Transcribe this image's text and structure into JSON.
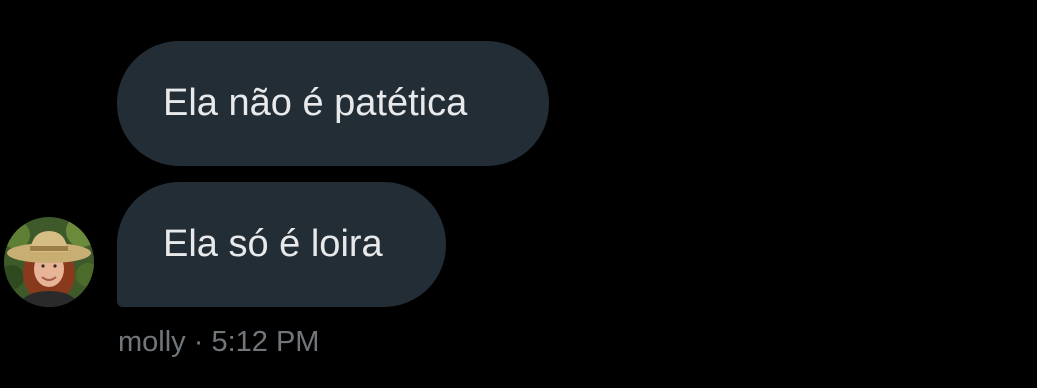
{
  "conversation": {
    "messages": [
      {
        "text": "Ela não é patética"
      },
      {
        "text": "Ela só é loira"
      }
    ],
    "sender": {
      "name": "molly",
      "separator": "·",
      "time": "5:12 PM",
      "avatar_icon": "user-avatar-photo"
    }
  },
  "colors": {
    "background": "#000000",
    "bubble": "#232d36",
    "bubble_text": "#e7e9ea",
    "meta_text": "#71767b"
  }
}
